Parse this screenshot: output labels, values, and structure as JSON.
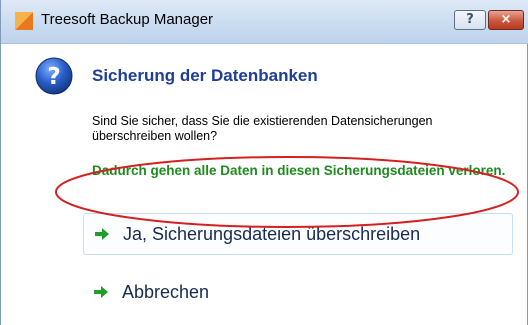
{
  "window": {
    "title": "Treesoft Backup Manager",
    "help_label": "?",
    "close_label": "×"
  },
  "dialog": {
    "main_instruction": "Sicherung der Datenbanken",
    "question": "Sind Sie sicher, dass Sie die existierenden Datensicherungen überschreiben wollen?",
    "warning": "Dadurch gehen alle Daten in diesen Sicherungsdateien verloren.",
    "commands": [
      {
        "label": "Ja, Sicherungsdateien überschreiben",
        "icon": "green-arrow-icon",
        "selected": true
      },
      {
        "label": "Abbrechen",
        "icon": "green-arrow-icon",
        "selected": false
      }
    ]
  },
  "colors": {
    "main_instruction": "#1f3f96",
    "warning": "#1e8b1e",
    "command_arrow": "#1f9e2c",
    "annotation_ellipse": "#d42020"
  }
}
